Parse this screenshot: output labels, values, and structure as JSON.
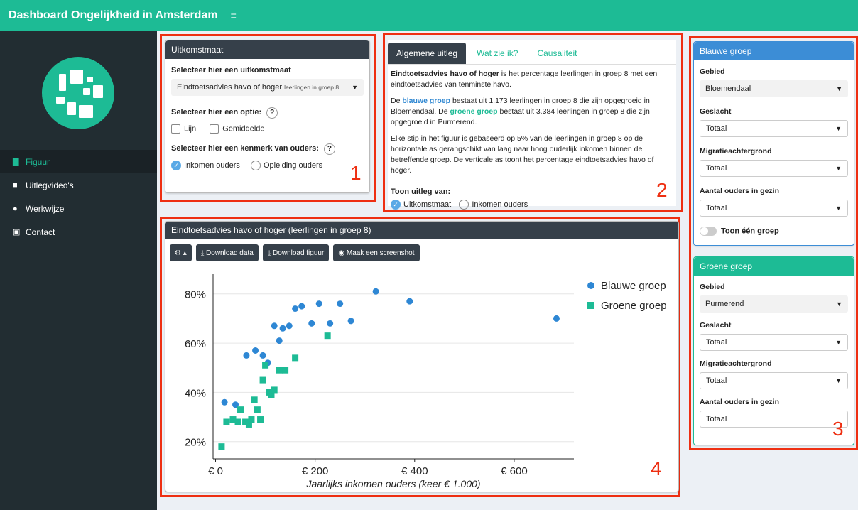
{
  "app": {
    "title": "Dashboard Ongelijkheid in Amsterdam",
    "menu_icon": "hamburger-icon"
  },
  "sidebar": {
    "items": [
      {
        "label": "Figuur",
        "icon": "bar-chart-icon",
        "active": true
      },
      {
        "label": "Uitlegvideo's",
        "icon": "video-camera-icon"
      },
      {
        "label": "Werkwijze",
        "icon": "info-icon"
      },
      {
        "label": "Contact",
        "icon": "address-card-icon"
      }
    ]
  },
  "annotations": [
    "1",
    "2",
    "3",
    "4"
  ],
  "uitkomstmaat": {
    "title": "Uitkomstmaat",
    "select_label": "Selecteer hier een uitkomstmaat",
    "select_value": "Eindtoetsadvies havo of hoger",
    "select_suffix": "leerlingen in groep 8",
    "option_label": "Selecteer hier een optie:",
    "help": "?",
    "checkbox_lijn": "Lijn",
    "checkbox_gemiddelde": "Gemiddelde",
    "kenmerk_label": "Selecteer hier een kenmerk van ouders:",
    "radio_inkomen": "Inkomen ouders",
    "radio_opleiding": "Opleiding ouders"
  },
  "explanation": {
    "tabs": [
      "Algemene uitleg",
      "Wat zie ik?",
      "Causaliteit"
    ],
    "p1_bold": "Eindtoetsadvies havo of hoger",
    "p1_rest": " is het percentage leerlingen in groep 8 met een eindtoetsadvies van tenminste havo.",
    "p2_a": "De ",
    "p2_blue": "blauwe groep",
    "p2_b": " bestaat uit 1.173 leerlingen in groep 8 die zijn opgegroeid in Bloemendaal. De ",
    "p2_green": "groene groep",
    "p2_c": " bestaat uit 3.384 leerlingen in groep 8 die zijn opgegroeid in Purmerend.",
    "p3": "Elke stip in het figuur is gebaseerd op 5% van de leerlingen in groep 8 op de horizontale as gerangschikt van laag naar hoog ouderlijk inkomen binnen de betreffende groep. De verticale as toont het percentage eindtoetsadvies havo of hoger.",
    "toon_label": "Toon uitleg van:",
    "radio_uitkomst": "Uitkomstmaat",
    "radio_inkomen": "Inkomen ouders"
  },
  "blue_group": {
    "title": "Blauwe groep",
    "color": "#3c8dd6",
    "gebied_label": "Gebied",
    "gebied": "Bloemendaal",
    "geslacht_label": "Geslacht",
    "geslacht": "Totaal",
    "migratie_label": "Migratieachtergrond",
    "migratie": "Totaal",
    "ouders_label": "Aantal ouders in gezin",
    "ouders": "Totaal",
    "toggle_label": "Toon één groep"
  },
  "green_group": {
    "title": "Groene groep",
    "color": "#1dbb95",
    "gebied_label": "Gebied",
    "gebied": "Purmerend",
    "geslacht_label": "Geslacht",
    "geslacht": "Totaal",
    "migratie_label": "Migratieachtergrond",
    "migratie": "Totaal",
    "ouders_label": "Aantal ouders in gezin",
    "ouders": "Totaal"
  },
  "chart_panel": {
    "title": "Eindtoetsadvies havo of hoger (leerlingen in groep 8)",
    "buttons": {
      "gear": "▴",
      "download_data": "Download data",
      "download_fig": "Download figuur",
      "screenshot": "Maak een screenshot"
    }
  },
  "chart_data": {
    "type": "scatter",
    "xlabel": "Jaarlijks inkomen ouders (keer € 1.000)",
    "ylabel": "",
    "xlim": [
      -5,
      720
    ],
    "ylim": [
      13,
      88
    ],
    "xticks": [
      0,
      200,
      400,
      600
    ],
    "xtick_labels": [
      "€ 0",
      "€ 200",
      "€ 400",
      "€ 600"
    ],
    "yticks": [
      20,
      40,
      60,
      80
    ],
    "ytick_labels": [
      "20%",
      "40%",
      "60%",
      "80%"
    ],
    "grid": true,
    "legend_position": "top-right",
    "series": [
      {
        "name": "Blauwe groep",
        "color": "#2e87d4",
        "marker": "circle",
        "points": [
          [
            18,
            36
          ],
          [
            40,
            35
          ],
          [
            62,
            55
          ],
          [
            80,
            57
          ],
          [
            95,
            55
          ],
          [
            105,
            52
          ],
          [
            118,
            67
          ],
          [
            128,
            61
          ],
          [
            135,
            66
          ],
          [
            148,
            67
          ],
          [
            160,
            74
          ],
          [
            173,
            75
          ],
          [
            193,
            68
          ],
          [
            208,
            76
          ],
          [
            230,
            68
          ],
          [
            250,
            76
          ],
          [
            272,
            69
          ],
          [
            322,
            81
          ],
          [
            390,
            77
          ],
          [
            685,
            70
          ]
        ]
      },
      {
        "name": "Groene groep",
        "color": "#1dbb95",
        "marker": "square",
        "points": [
          [
            12,
            18
          ],
          [
            22,
            28
          ],
          [
            35,
            29
          ],
          [
            45,
            28
          ],
          [
            50,
            33
          ],
          [
            60,
            28
          ],
          [
            67,
            27
          ],
          [
            72,
            29
          ],
          [
            78,
            37
          ],
          [
            84,
            33
          ],
          [
            90,
            29
          ],
          [
            95,
            45
          ],
          [
            100,
            51
          ],
          [
            108,
            40
          ],
          [
            112,
            39
          ],
          [
            118,
            41
          ],
          [
            128,
            49
          ],
          [
            140,
            49
          ],
          [
            160,
            54
          ],
          [
            225,
            63
          ]
        ]
      }
    ]
  }
}
